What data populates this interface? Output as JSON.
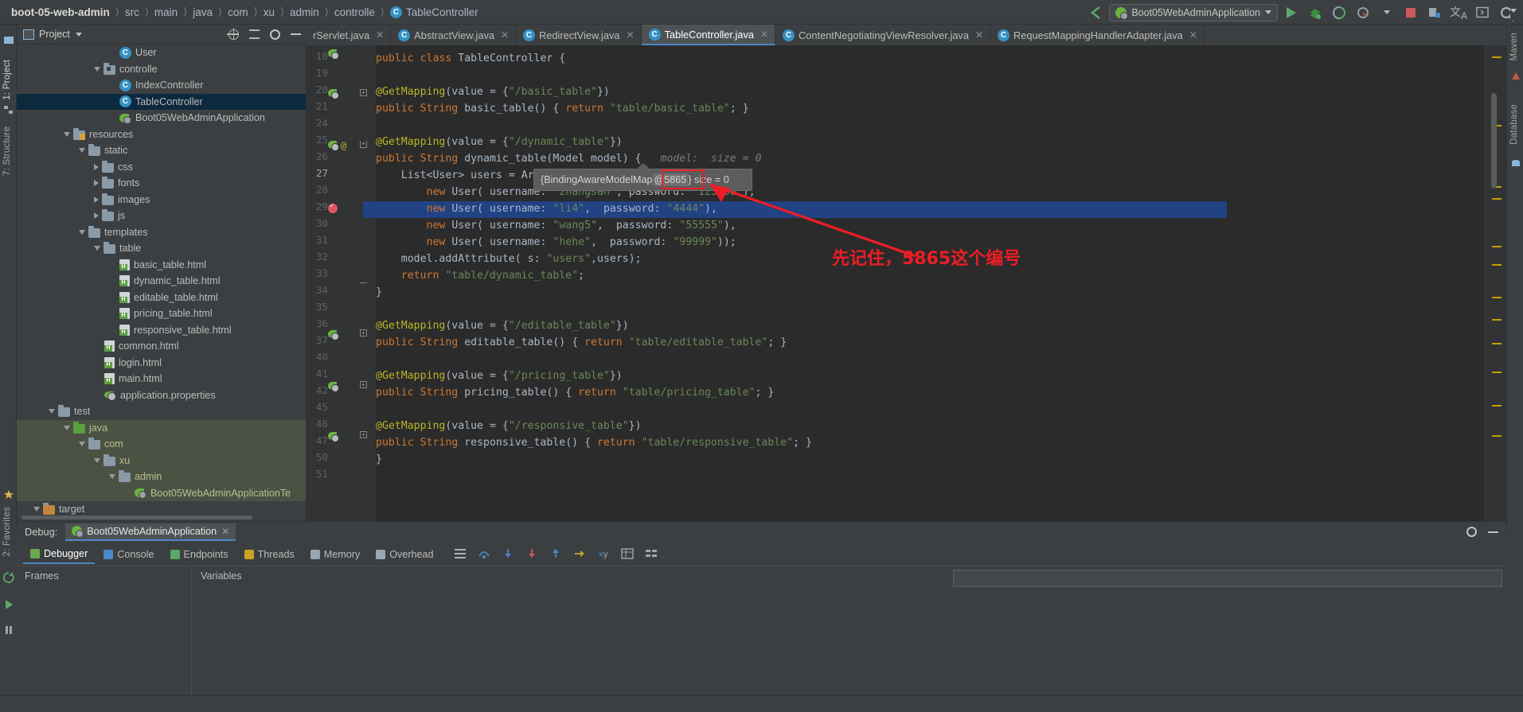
{
  "breadcrumb": {
    "items": [
      "boot-05-web-admin",
      "src",
      "main",
      "java",
      "com",
      "xu",
      "admin",
      "controlle"
    ],
    "current_file": "TableController",
    "class_icon": "C"
  },
  "toolbar": {
    "run_configuration": "Boot05WebAdminApplication",
    "icons": [
      "back-arrow-icon",
      "spring-boot-icon",
      "run-icon",
      "debug-icon",
      "run-coverage-icon",
      "profiler-icon",
      "stop-icon",
      "build-icon",
      "translate-icon",
      "terminal-icon",
      "search-everywhere-icon"
    ]
  },
  "left_rail": {
    "items": [
      "1: Project",
      "7: Structure",
      "2: Favorites"
    ]
  },
  "right_rail": {
    "items": [
      "Maven",
      "Database"
    ]
  },
  "project_panel": {
    "title": "Project",
    "actions": [
      "locate-icon",
      "collapse-all-icon",
      "settings-icon",
      "hide-icon"
    ],
    "tree": [
      {
        "label": "User",
        "indent": 6,
        "arrow": "none",
        "icon": "class-icon",
        "state": "normal"
      },
      {
        "label": "controlle",
        "indent": 5,
        "arrow": "down",
        "icon": "folder-controller-icon",
        "state": "normal"
      },
      {
        "label": "IndexController",
        "indent": 6,
        "arrow": "none",
        "icon": "class-icon",
        "state": "normal"
      },
      {
        "label": "TableController",
        "indent": 6,
        "arrow": "none",
        "icon": "class-icon",
        "state": "selected"
      },
      {
        "label": "Boot05WebAdminApplication",
        "indent": 6,
        "arrow": "none",
        "icon": "spring-icon",
        "state": "normal"
      },
      {
        "label": "resources",
        "indent": 3,
        "arrow": "down",
        "icon": "folder-resources-icon",
        "state": "normal"
      },
      {
        "label": "static",
        "indent": 4,
        "arrow": "down",
        "icon": "folder-icon",
        "state": "normal"
      },
      {
        "label": "css",
        "indent": 5,
        "arrow": "right",
        "icon": "folder-icon",
        "state": "normal"
      },
      {
        "label": "fonts",
        "indent": 5,
        "arrow": "right",
        "icon": "folder-icon",
        "state": "normal"
      },
      {
        "label": "images",
        "indent": 5,
        "arrow": "right",
        "icon": "folder-icon",
        "state": "normal"
      },
      {
        "label": "js",
        "indent": 5,
        "arrow": "right",
        "icon": "folder-icon",
        "state": "normal"
      },
      {
        "label": "templates",
        "indent": 4,
        "arrow": "down",
        "icon": "folder-icon",
        "state": "normal"
      },
      {
        "label": "table",
        "indent": 5,
        "arrow": "down",
        "icon": "folder-icon",
        "state": "normal"
      },
      {
        "label": "basic_table.html",
        "indent": 6,
        "arrow": "none",
        "icon": "html-icon",
        "state": "normal"
      },
      {
        "label": "dynamic_table.html",
        "indent": 6,
        "arrow": "none",
        "icon": "html-icon",
        "state": "normal"
      },
      {
        "label": "editable_table.html",
        "indent": 6,
        "arrow": "none",
        "icon": "html-icon",
        "state": "normal"
      },
      {
        "label": "pricing_table.html",
        "indent": 6,
        "arrow": "none",
        "icon": "html-icon",
        "state": "normal"
      },
      {
        "label": "responsive_table.html",
        "indent": 6,
        "arrow": "none",
        "icon": "html-icon",
        "state": "normal"
      },
      {
        "label": "common.html",
        "indent": 5,
        "arrow": "none",
        "icon": "html-icon",
        "state": "normal"
      },
      {
        "label": "login.html",
        "indent": 5,
        "arrow": "none",
        "icon": "html-icon",
        "state": "normal"
      },
      {
        "label": "main.html",
        "indent": 5,
        "arrow": "none",
        "icon": "html-icon",
        "state": "normal"
      },
      {
        "label": "application.properties",
        "indent": 5,
        "arrow": "none",
        "icon": "properties-icon",
        "state": "normal"
      },
      {
        "label": "test",
        "indent": 2,
        "arrow": "down",
        "icon": "folder-icon",
        "state": "normal"
      },
      {
        "label": "java",
        "indent": 3,
        "arrow": "down",
        "icon": "folder-green-icon",
        "state": "modified"
      },
      {
        "label": "com",
        "indent": 4,
        "arrow": "down",
        "icon": "folder-icon",
        "state": "modified"
      },
      {
        "label": "xu",
        "indent": 5,
        "arrow": "down",
        "icon": "folder-icon",
        "state": "modified"
      },
      {
        "label": "admin",
        "indent": 6,
        "arrow": "down",
        "icon": "folder-icon",
        "state": "modified"
      },
      {
        "label": "Boot05WebAdminApplicationTe",
        "indent": 7,
        "arrow": "none",
        "icon": "spring-icon",
        "state": "modified"
      },
      {
        "label": "target",
        "indent": 1,
        "arrow": "down",
        "icon": "folder-orange-icon",
        "state": "normal"
      }
    ]
  },
  "editor_tabs": [
    {
      "label": "rServlet.java",
      "active": false,
      "truncated": true
    },
    {
      "label": "AbstractView.java",
      "active": false
    },
    {
      "label": "RedirectView.java",
      "active": false
    },
    {
      "label": "TableController.java",
      "active": true
    },
    {
      "label": "ContentNegotiatingViewResolver.java",
      "active": false
    },
    {
      "label": "RequestMappingHandlerAdapter.java",
      "active": false
    }
  ],
  "code": {
    "lines": [
      {
        "num": "18",
        "text": "public class TableController {",
        "partial": true
      },
      {
        "num": "19",
        "text": ""
      },
      {
        "num": "20",
        "text": "@GetMapping(value = {\"/basic_table\"})"
      },
      {
        "num": "21",
        "text": "public String basic_table() { return \"table/basic_table\"; }"
      },
      {
        "num": "24",
        "text": ""
      },
      {
        "num": "25",
        "text": "@GetMapping(value = {\"/dynamic_table\"})"
      },
      {
        "num": "26",
        "text": "public String dynamic_table(Model model) {   model:  size = 0"
      },
      {
        "num": "27",
        "text": "    List<User> users = Arrays.asList("
      },
      {
        "num": "28",
        "text": "        new User( username: \"zhangsan\", password: \"123456\"),"
      },
      {
        "num": "29",
        "text": "        new User( username: \"li4\",  password: \"4444\"),"
      },
      {
        "num": "30",
        "text": "        new User( username: \"wang5\",  password: \"55555\"),"
      },
      {
        "num": "31",
        "text": "        new User( username: \"hehe\",  password: \"99999\"));"
      },
      {
        "num": "32",
        "text": "    model.addAttribute( s: \"users\",users);"
      },
      {
        "num": "33",
        "text": "    return \"table/dynamic_table\";"
      },
      {
        "num": "34",
        "text": "}"
      },
      {
        "num": "35",
        "text": ""
      },
      {
        "num": "36",
        "text": "@GetMapping(value = {\"/editable_table\"})"
      },
      {
        "num": "37",
        "text": "public String editable_table() { return \"table/editable_table\"; }"
      },
      {
        "num": "40",
        "text": ""
      },
      {
        "num": "41",
        "text": "@GetMapping(value = {\"/pricing_table\"})"
      },
      {
        "num": "42",
        "text": "public String pricing_table() { return \"table/pricing_table\"; }"
      },
      {
        "num": "45",
        "text": ""
      },
      {
        "num": "46",
        "text": "@GetMapping(value = {\"/responsive_table\"})"
      },
      {
        "num": "47",
        "text": "public String responsive_table() { return \"table/responsive_table\"; }"
      },
      {
        "num": "50",
        "text": "}"
      },
      {
        "num": "51",
        "text": ""
      }
    ],
    "highlighted_line": "27",
    "breakpoint_line": "27",
    "inline_debug_hint": "model:  size = 0"
  },
  "tooltip": {
    "prefix": "{BindingAwareModelMap",
    "id": "@5865",
    "suffix": "} size = 0"
  },
  "annotation": {
    "text": "先记住，5865这个编号",
    "color": "#ee1c25",
    "arrow_color": "#ee1c25",
    "highlight_box_color": "#ee1c25"
  },
  "debug_panel": {
    "label": "Debug:",
    "session": "Boot05WebAdminApplication",
    "tabs": [
      {
        "label": "Debugger",
        "active": true,
        "icon": "debugger-icon"
      },
      {
        "label": "Console",
        "active": false,
        "icon": "console-icon"
      },
      {
        "label": "Endpoints",
        "active": false,
        "icon": "endpoints-icon"
      },
      {
        "label": "Threads",
        "active": false,
        "icon": "threads-icon"
      },
      {
        "label": "Memory",
        "active": false,
        "icon": "memory-icon"
      },
      {
        "label": "Overhead",
        "active": false,
        "icon": "overhead-icon"
      }
    ],
    "tool_icons": [
      "layout-icon",
      "step-over-icon",
      "step-into-icon",
      "force-step-into-icon",
      "step-out-icon",
      "run-to-cursor-icon",
      "evaluate-icon",
      "watches-icon",
      "mute-breakpoints-icon"
    ],
    "columns": {
      "frames": "Frames",
      "variables": "Variables"
    },
    "header_icons": [
      "settings-icon",
      "hide-icon",
      "restore-layout-icon"
    ]
  },
  "colors": {
    "accent_blue": "#4a88c7",
    "selection_blue": "#214283",
    "tree_selected": "#0d293e",
    "tree_modified": "#4b5244",
    "spring_green": "#6db33f",
    "editor_bg": "#2b2b2b",
    "panel_bg": "#3c3f41",
    "annotation_red": "#ee1c25"
  }
}
